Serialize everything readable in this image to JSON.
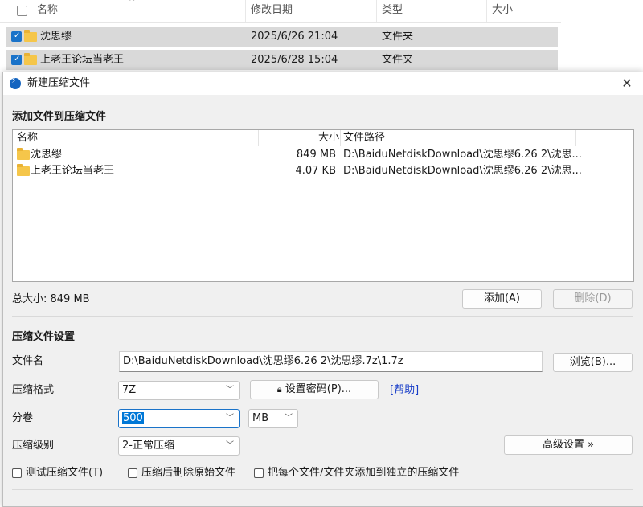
{
  "explorer": {
    "columns": {
      "name": "名称",
      "date": "修改日期",
      "type": "类型",
      "size": "大小"
    },
    "rows": [
      {
        "name": "沈思缪",
        "date": "2025/6/26 21:04",
        "type": "文件夹"
      },
      {
        "name": "上老王论坛当老王",
        "date": "2025/6/28 15:04",
        "type": "文件夹"
      }
    ]
  },
  "dialog": {
    "title": "新建压缩文件",
    "close_glyph": "✕",
    "add_section_title": "添加文件到压缩文件",
    "list": {
      "headers": {
        "name": "名称",
        "size": "大小",
        "path": "文件路径"
      },
      "rows": [
        {
          "name": "沈思缪",
          "size": "849 MB",
          "path": "D:\\BaiduNetdiskDownload\\沈思缪6.26 2\\沈思..."
        },
        {
          "name": "上老王论坛当老王",
          "size": "4.07 KB",
          "path": "D:\\BaiduNetdiskDownload\\沈思缪6.26 2\\沈思..."
        }
      ]
    },
    "total_size": "总大小: 849 MB",
    "add_button": "添加(A)",
    "delete_button": "删除(D)",
    "settings_title": "压缩文件设置",
    "filename_label": "文件名",
    "filename_value": "D:\\BaiduNetdiskDownload\\沈思缪6.26 2\\沈思缪.7z\\1.7z",
    "browse_button": "浏览(B)...",
    "format_label": "压缩格式",
    "format_value": "7Z",
    "password_button": "设置密码(P)...",
    "help_link": "[帮助]",
    "volume_label": "分卷",
    "volume_value": "500",
    "volume_unit": "MB",
    "level_label": "压缩级别",
    "level_value": "2-正常压缩",
    "advanced_button": "高级设置 »",
    "options": {
      "test": "测试压缩文件(T)",
      "delete_after": "压缩后删除原始文件",
      "separate": "把每个文件/文件夹添加到独立的压缩文件"
    }
  },
  "colors": {
    "accent": "#1a73c9",
    "selection": "#0078d7",
    "link": "#1a3fc9"
  }
}
